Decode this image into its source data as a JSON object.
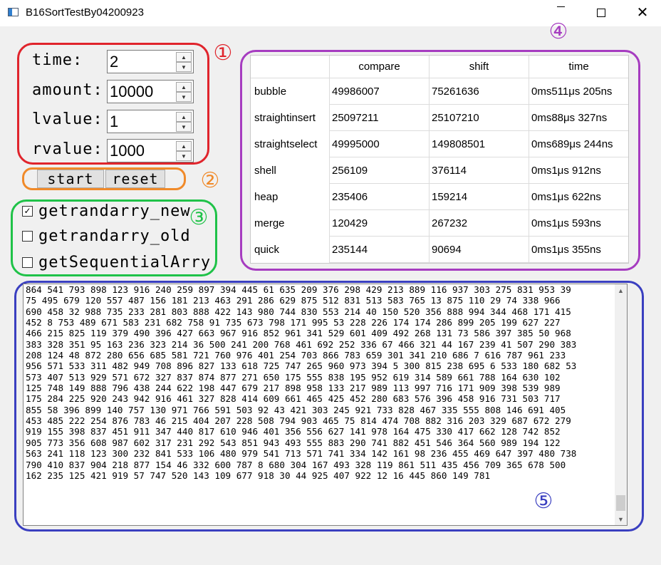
{
  "window": {
    "title": "B16SortTestBy04200923",
    "close_glyph": "✕"
  },
  "params": {
    "time_label": "time:",
    "time_value": "2",
    "amount_label": "amount:",
    "amount_value": "10000",
    "lvalue_label": "lvalue:",
    "lvalue_value": "1",
    "rvalue_label": "rvalue:",
    "rvalue_value": "1000",
    "spin_up_glyph": "▲",
    "spin_down_glyph": "▼"
  },
  "buttons": {
    "start_label": "start",
    "reset_label": "reset"
  },
  "options": [
    {
      "label": "getrandarry_new",
      "checked": true,
      "mark": "✓"
    },
    {
      "label": "getrandarry_old",
      "checked": false,
      "mark": ""
    },
    {
      "label": "getSequentialArry",
      "checked": false,
      "mark": ""
    }
  ],
  "annotations": [
    "①",
    "②",
    "③",
    "④",
    "⑤"
  ],
  "table": {
    "columns": [
      "compare",
      "shift",
      "time"
    ],
    "rows": [
      {
        "name": "bubble",
        "compare": "49986007",
        "shift": "75261636",
        "time": "0ms511μs 205ns"
      },
      {
        "name": "straightinsert",
        "compare": "25097211",
        "shift": "25107210",
        "time": "0ms88μs 327ns"
      },
      {
        "name": "straightselect",
        "compare": "49995000",
        "shift": "149808501",
        "time": "0ms689μs 244ns"
      },
      {
        "name": "shell",
        "compare": "256109",
        "shift": "376114",
        "time": "0ms1μs 912ns"
      },
      {
        "name": "heap",
        "compare": "235406",
        "shift": "159214",
        "time": "0ms1μs 622ns"
      },
      {
        "name": "merge",
        "compare": "120429",
        "shift": "267232",
        "time": "0ms1μs 593ns"
      },
      {
        "name": "quick",
        "compare": "235144",
        "shift": "90694",
        "time": "0ms1μs 355ns"
      }
    ]
  },
  "output": {
    "text": "864 541 793 898 123 916 240 259 897 394 445 61 635 209 376 298 429 213 889 116 937 303 275 831 953 39\n75 495 679 120 557 487 156 181 213 463 291 286 629 875 512 831 513 583 765 13 875 110 29 74 338 966\n690 458 32 988 735 233 281 803 888 422 143 980 744 830 553 214 40 150 520 356 888 994 344 468 171 415\n452 8 753 489 671 583 231 682 758 91 735 673 798 171 995 53 228 226 174 174 286 899 205 199 627 227\n466 215 825 119 379 490 396 427 663 967 916 852 961 341 529 601 409 492 268 131 73 586 397 385 50 968\n383 328 351 95 163 236 323 214 36 500 241 200 768 461 692 252 336 67 466 321 44 167 239 41 507 290 383\n208 124 48 872 280 656 685 581 721 760 976 401 254 703 866 783 659 301 341 210 686 7 616 787 961 233\n956 571 533 311 482 949 708 896 827 133 618 725 747 265 960 973 394 5 300 815 238 695 6 533 180 682 53\n573 407 513 929 571 672 327 837 874 877 271 650 175 555 838 195 952 619 314 589 661 788 164 630 102\n125 748 149 888 796 438 244 622 198 447 679 217 898 958 133 217 989 113 997 716 171 909 398 539 989\n175 284 225 920 243 942 916 461 327 828 414 609 661 465 425 452 280 683 576 396 458 916 731 503 717\n855 58 396 899 140 757 130 971 766 591 503 92 43 421 303 245 921 733 828 467 335 555 808 146 691 405\n453 485 222 254 876 783 46 215 404 207 228 508 794 903 465 75 814 474 708 882 316 203 329 687 672 279\n919 155 398 837 451 911 347 440 817 610 946 401 356 556 627 141 978 164 475 330 417 662 128 742 852\n905 773 356 608 987 602 317 231 292 543 851 943 493 555 883 290 741 882 451 546 364 560 989 194 122\n563 241 118 123 300 232 841 533 106 480 979 541 713 571 741 334 142 161 98 236 455 469 647 397 480 738\n790 410 837 904 218 877 154 46 332 600 787 8 680 304 167 493 328 119 861 511 435 456 709 365 678 500\n162 235 125 421 919 57 747 520 143 109 677 918 30 44 925 407 922 12 16 445 860 149 781"
  },
  "scrollbar": {
    "up_glyph": "▲",
    "down_glyph": "▼"
  },
  "colors": {
    "anno_1": "#e0242c",
    "anno_2": "#f08a2a",
    "anno_3": "#1fc248",
    "anno_4": "#a63cc0",
    "anno_5": "#3a3fc0"
  }
}
